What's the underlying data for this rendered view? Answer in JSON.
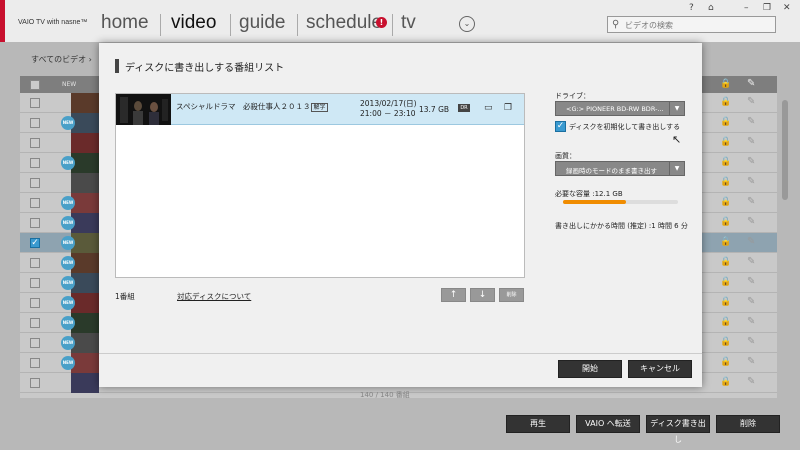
{
  "app": {
    "brand": "VAIO TV with nasne™",
    "nav": [
      "home",
      "video",
      "guide",
      "schedule",
      "tv"
    ],
    "active_nav": "video",
    "search_placeholder": "ビデオの検索",
    "top_icons": {
      "help": "?",
      "device": "⌂",
      "minimize": "–",
      "restore": "❐",
      "close": "✕"
    }
  },
  "breadcrumb": "すべてのビデオ",
  "list": {
    "header_new": "NEW",
    "footer": "140 / 140 番組",
    "row_count": 15,
    "selected_row": 7,
    "new_badge_rows": [
      1,
      3,
      5,
      6,
      7,
      8,
      9,
      10,
      11,
      12,
      13
    ],
    "new_badge_text": "NEW"
  },
  "bottom_buttons": [
    "再生",
    "VAIO へ転送",
    "ディスク書き出し",
    "削除"
  ],
  "modal": {
    "title": "ディスクに書き出しする番組リスト",
    "program": {
      "title": "スペシャルドラマ　必殺仕事人２０１３",
      "tag": "解字",
      "date": "2013/02/17(日)",
      "time": "21:00 － 23:10",
      "size": "13.7 GB",
      "badge": "DR"
    },
    "count": "1番組",
    "disc_link": "対応ディスクについて",
    "move_up": "↑",
    "move_down": "↓",
    "delete_btn": "削除",
    "drive_label": "ドライブ：",
    "drive_value": "<G:> PIONEER BD-RW BDR-...",
    "init_checkbox_label": "ディスクを初期化して書き出しする",
    "init_checked": true,
    "quality_label": "画質：",
    "quality_value": "録画時のモードのまま書き出す",
    "capacity_label": "必要な容量 :12.1 GB",
    "capacity_fraction": 0.55,
    "time_label": "書き出しにかかる時間 (推定) :1 時間 6 分",
    "start_btn": "開始",
    "cancel_btn": "キャンセル"
  },
  "colors": {
    "accent_blue": "#3a9ad0",
    "selected_row": "#cfe8f5",
    "capacity_orange": "#f08c00",
    "alert_red": "#c8102e"
  }
}
